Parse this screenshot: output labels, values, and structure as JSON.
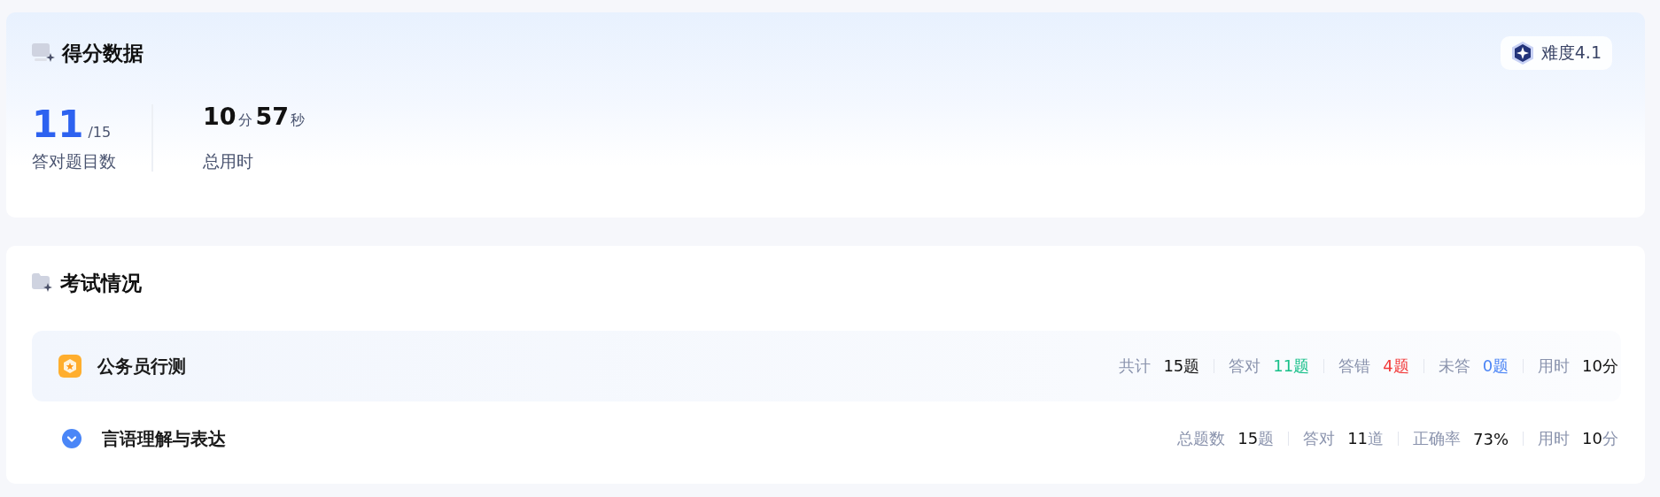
{
  "score_card": {
    "title": "得分数据",
    "difficulty": "难度4.1",
    "correct": {
      "value": "11",
      "total": "/15",
      "label": "答对题目数"
    },
    "time": {
      "parts": [
        {
          "kind": "number",
          "text": "10"
        },
        {
          "kind": "unit",
          "text": "分"
        },
        {
          "kind": "number",
          "text": "57"
        },
        {
          "kind": "unit",
          "text": "秒"
        }
      ],
      "label": "总用时"
    }
  },
  "exam_card": {
    "title": "考试情况",
    "exam": {
      "name": "公务员行测",
      "stats": [
        {
          "label": "共计",
          "value": "15题",
          "color": "#111111"
        },
        {
          "label": "答对",
          "value": "11题",
          "color": "#19c08a"
        },
        {
          "label": "答错",
          "value": "4题",
          "color": "#f23a3a"
        },
        {
          "label": "未答",
          "value": "0题",
          "color": "#4b84f5"
        },
        {
          "label": "用时",
          "value": "10分",
          "color": "#111111"
        }
      ]
    },
    "sections": [
      {
        "name": "言语理解与表达",
        "expanded": true,
        "stats": [
          {
            "label": "总题数",
            "value": "15",
            "unit": "题"
          },
          {
            "label": "答对",
            "value": "11",
            "unit": "道"
          },
          {
            "label": "正确率",
            "value": "73%"
          },
          {
            "label": "用时",
            "value": "10",
            "unit": "分"
          }
        ]
      }
    ]
  }
}
